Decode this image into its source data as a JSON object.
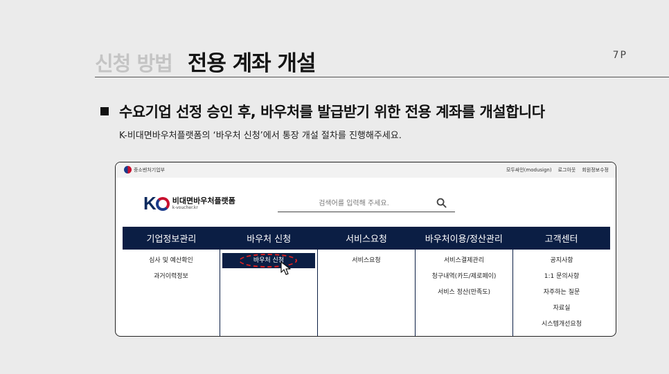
{
  "slide": {
    "section": "신청 방법",
    "title": "전용 계좌 개설",
    "page": "7P",
    "headline": "수요기업 선정 승인 후, 바우처를 발급받기 위한 전용 계좌를 개설합니다",
    "subtext": "K-비대면바우처플랫폼의 ‘바우처 신청’에서 통장 개설 절차를 진행해주세요."
  },
  "site": {
    "gov_label": "중소벤처기업부",
    "top_links": [
      "모두싸인(modusign)",
      "로그아웃",
      "회원정보수정"
    ],
    "brand_name": "비대면바우처플랫폼",
    "brand_url": "k-voucher.kr",
    "search_placeholder": "검색어를 입력해 주세요.",
    "nav": [
      {
        "label": "기업정보관리",
        "items": [
          "심사 및 예산확인",
          "과거이력정보"
        ]
      },
      {
        "label": "바우처 신청",
        "items": [
          "바우처 신청"
        ]
      },
      {
        "label": "서비스요청",
        "items": [
          "서비스요청"
        ]
      },
      {
        "label": "바우처이용/정산관리",
        "items": [
          "서비스결제관리",
          "청구내역(카드/제로페이)",
          "서비스 정산(만족도)"
        ]
      },
      {
        "label": "고객센터",
        "items": [
          "공지사항",
          "1:1 문의사항",
          "자주하는 질문",
          "자료실",
          "시스템개선요청"
        ]
      }
    ]
  },
  "colors": {
    "navy": "#0b1e44",
    "highlight": "#e02020",
    "brand_red": "#c8102e",
    "brand_blue": "#1a3a8a"
  }
}
